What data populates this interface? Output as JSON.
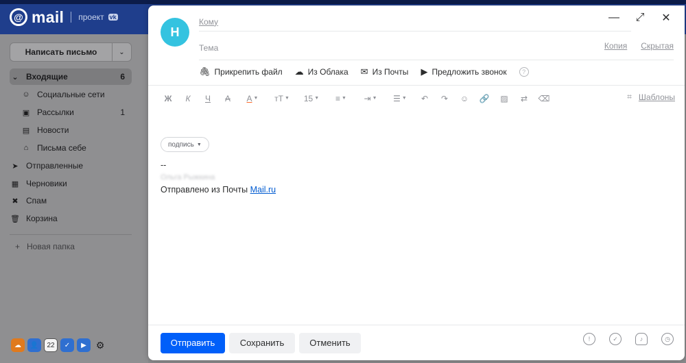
{
  "header": {
    "logo_at": "@",
    "logo_word": "mail",
    "project_label": "проект",
    "project_badge": "vk"
  },
  "sidebar": {
    "compose_label": "Написать письмо",
    "compose_dropdown": "⌄",
    "folders": [
      {
        "label": "Входящие",
        "count": "6",
        "icon": "inbox-icon"
      },
      {
        "label": "Социальные сети",
        "count": "",
        "icon": "social-icon"
      },
      {
        "label": "Рассылки",
        "count": "1",
        "icon": "newsletter-icon"
      },
      {
        "label": "Новости",
        "count": "",
        "icon": "news-icon"
      },
      {
        "label": "Письма себе",
        "count": "",
        "icon": "self-mail-icon"
      },
      {
        "label": "Отправленные",
        "count": "",
        "icon": "sent-icon"
      },
      {
        "label": "Черновики",
        "count": "",
        "icon": "drafts-icon"
      },
      {
        "label": "Спам",
        "count": "",
        "icon": "spam-icon"
      },
      {
        "label": "Корзина",
        "count": "",
        "icon": "trash-icon"
      }
    ],
    "new_folder": "Новая папка",
    "new_folder_plus": "+",
    "calendar_day": "22"
  },
  "compose": {
    "avatar_letter": "Н",
    "to_label": "Кому",
    "subject_placeholder": "Тема",
    "cc_label": "Копия",
    "bcc_label": "Скрытая",
    "attach": {
      "file": "Прикрепить файл",
      "cloud": "Из Облака",
      "mail": "Из Почты",
      "call": "Предложить звонок",
      "help": "?"
    },
    "toolbar": {
      "bold": "Ж",
      "italic": "К",
      "underline": "Ч",
      "strike": "А",
      "color": "А",
      "font_size_icon": "тТ",
      "font_size_value": "15",
      "templates_label": "Шаблоны"
    },
    "signature_pill": "подпись",
    "body": {
      "dashes": "--",
      "name_blurred": "Ольга Рыжкина",
      "sent_from": "Отправлено из Почты ",
      "link": "Mail.ru"
    },
    "footer": {
      "send": "Отправить",
      "save": "Сохранить",
      "cancel": "Отменить"
    }
  }
}
